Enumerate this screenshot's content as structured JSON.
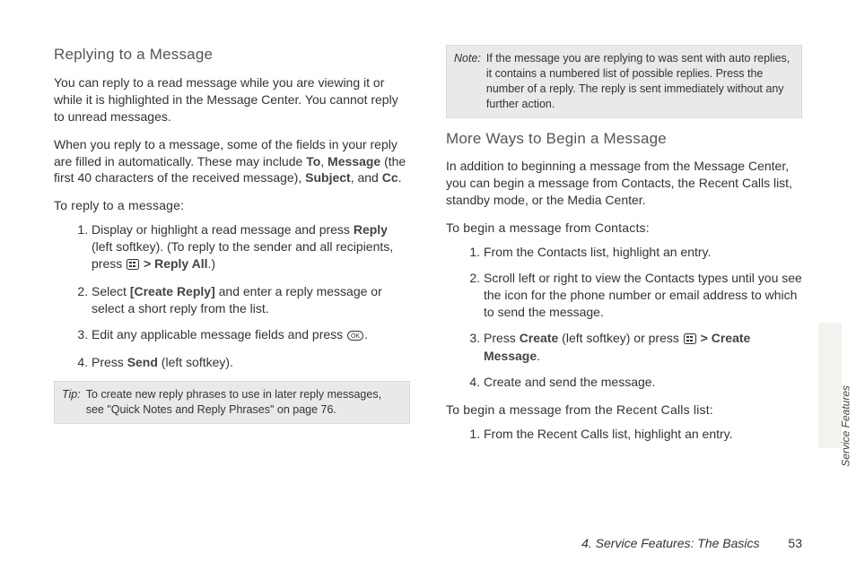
{
  "sidebar_tab": "Service Features",
  "footer": {
    "chapter": "4. Service Features: The Basics",
    "page": "53"
  },
  "left": {
    "h1": "Replying to a Message",
    "p1": "You can reply to a read message while you are viewing it or while it is highlighted in the Message Center. You cannot reply to unread messages.",
    "p2a": "When you reply to a message, some of the fields in your reply are filled in automatically. These may include ",
    "b_to": "To",
    "sep1": ", ",
    "b_msg": "Message",
    "p2b": " (the first 40 characters of the received message), ",
    "b_subj": "Subject",
    "sep2": ", and ",
    "b_cc": "Cc",
    "p2c": ".",
    "sub1": "To reply to a message:",
    "li1a": "Display or highlight a read message and press ",
    "b_reply": "Reply",
    "li1b": " (left softkey). (To reply to the sender and all recipients, press ",
    "gt": " > ",
    "b_replyall": "Reply All",
    "li1c": ".)",
    "li2a": "Select ",
    "b_create": "[Create Reply]",
    "li2b": " and enter a reply message or select a short reply from the list.",
    "li3": "Edit any applicable message fields and press ",
    "li3b": ".",
    "li4a": "Press ",
    "b_send": "Send",
    "li4b": " (left softkey).",
    "tip_label": "Tip:",
    "tip_body": "To create new reply phrases to use in later reply messages, see \"Quick Notes and Reply Phrases\" on page 76."
  },
  "right": {
    "note_label": "Note:",
    "note_body": "If the message you are replying to was sent with auto replies, it contains a numbered list of possible replies. Press the number of a reply. The reply is sent immediately without any further action.",
    "h1": "More Ways to Begin a Message",
    "p1": "In addition to beginning a message from the Message Center, you can begin a message from Contacts, the Recent Calls list, standby mode, or the Media Center.",
    "sub1": "To begin a message from Contacts:",
    "li1": "From the Contacts list, highlight an entry.",
    "li2": "Scroll left or right to view the Contacts types until you see the icon for the phone number or email address to which to send the message.",
    "li3a": "Press ",
    "b_create": "Create",
    "li3b": " (left softkey) or press ",
    "gt": " > ",
    "b_createmsg": "Create Message",
    "li3c": ".",
    "li4": "Create and send the message.",
    "sub2": "To begin a message from the Recent Calls list:",
    "li5": "From the Recent Calls list, highlight an entry."
  }
}
